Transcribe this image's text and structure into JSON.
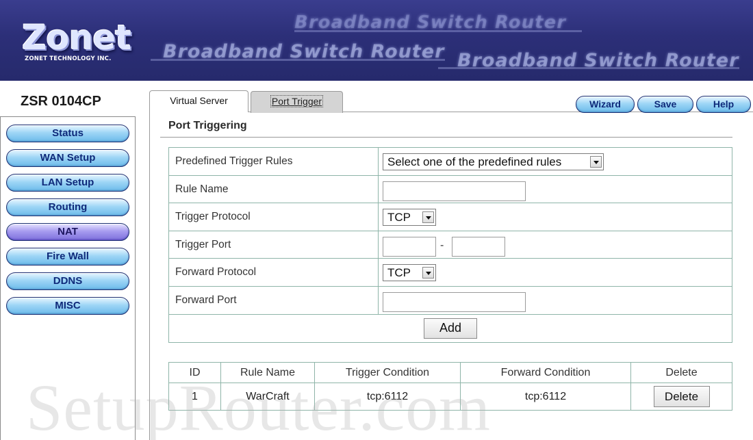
{
  "header": {
    "logo_text": "Zonet",
    "logo_subtitle": "ZONET TECHNOLOGY INC.",
    "banner_texts": [
      "Broadband Switch Router",
      "Broadband Switch Router",
      "Broadband Switch Router"
    ]
  },
  "sidebar": {
    "model": "ZSR 0104CP",
    "items": [
      {
        "label": "Status"
      },
      {
        "label": "WAN Setup"
      },
      {
        "label": "LAN Setup"
      },
      {
        "label": "Routing"
      },
      {
        "label": "NAT",
        "active": true
      },
      {
        "label": "Fire Wall"
      },
      {
        "label": "DDNS"
      },
      {
        "label": "MISC"
      }
    ]
  },
  "tabs": [
    {
      "label": "Virtual Server"
    },
    {
      "label": "Port Trigger",
      "selected": true
    }
  ],
  "actions": {
    "wizard": "Wizard",
    "save": "Save",
    "help": "Help"
  },
  "section_title": "Port Triggering",
  "form": {
    "predefined_label": "Predefined Trigger Rules",
    "predefined_value": "Select one of the predefined rules",
    "rule_name_label": "Rule Name",
    "rule_name_value": "",
    "trigger_protocol_label": "Trigger Protocol",
    "trigger_protocol_value": "TCP",
    "trigger_port_label": "Trigger Port",
    "trigger_port_from": "",
    "trigger_port_separator": "-",
    "trigger_port_to": "",
    "forward_protocol_label": "Forward Protocol",
    "forward_protocol_value": "TCP",
    "forward_port_label": "Forward Port",
    "forward_port_value": "",
    "add_button": "Add"
  },
  "rules_table": {
    "headers": [
      "ID",
      "Rule Name",
      "Trigger Condition",
      "Forward Condition",
      "Delete"
    ],
    "rows": [
      {
        "id": "1",
        "rule_name": "WarCraft",
        "trigger_condition": "tcp:6112",
        "forward_condition": "tcp:6112",
        "delete_label": "Delete"
      }
    ]
  },
  "watermark": "SetupRouter.com",
  "colors": {
    "header_bg": "#2c2f78",
    "nav_button": "#9fd6f6",
    "nav_active": "#a79cf0",
    "table_border": "#8eb4a8"
  }
}
